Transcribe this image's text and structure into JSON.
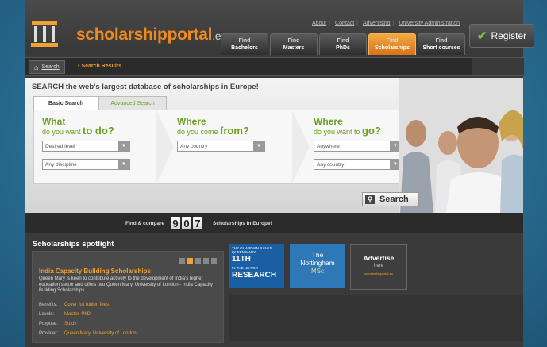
{
  "site": {
    "name": "scholarshipportal",
    "suffix": ".eu"
  },
  "top_links": [
    "About",
    "Contact",
    "Advertising",
    "University Administration"
  ],
  "nav_tabs": [
    {
      "line1": "Find",
      "line2": "Bachelors"
    },
    {
      "line1": "Find",
      "line2": "Masters"
    },
    {
      "line1": "Find",
      "line2": "PhDs"
    },
    {
      "line1": "Find",
      "line2": "Scholarships"
    },
    {
      "line1": "Find",
      "line2": "Short courses"
    }
  ],
  "register_label": "Register",
  "breadcrumb": {
    "home": "Search",
    "current": "Search Results"
  },
  "search": {
    "title": "SEARCH the web's largest database of scholarships in Europe!",
    "tabs": [
      "Basic Search",
      "Advanced Search"
    ],
    "col1": {
      "q1": "What",
      "q2a": "do you want ",
      "q2b": "to do?",
      "sel1": "Desired level",
      "sel2": "Any discipline"
    },
    "col2": {
      "q1": "Where",
      "q2a": "do you come ",
      "q2b": "from?",
      "sel1": "Any country"
    },
    "col3": {
      "q1": "Where",
      "q2a": "do you want to ",
      "q2b": "go?",
      "sel1": "Anywhere",
      "sel2": "Any country"
    },
    "button": "Search"
  },
  "counter": {
    "left": "Find & compare",
    "digits": [
      "9",
      "0",
      "7"
    ],
    "right": "Scholarships in Europe!"
  },
  "spotlight": {
    "title": "Scholarships spotlight",
    "pager_active": 1,
    "item_title": "India Capacity Building Scholarships",
    "item_desc": "Queen Mary is keen to contribute actively to the development of India's higher education sector and offers two Queen Mary, University of London - India Capacity Building Scholarships.",
    "benefits_label": "Benefits:",
    "benefits": "Cover full tuition fees",
    "levels_label": "Levels:",
    "levels": "Master, PhD",
    "purpose_label": "Purpose:",
    "purpose": "Study",
    "provider_label": "Provider:",
    "provider": "Queen Mary, University of London"
  },
  "ads": {
    "ad1": {
      "small": "THE GUARDIAN RANKS QUEEN MARY",
      "l1": "11TH",
      "l2": "IN THE UK FOR",
      "l3": "RESEARCH"
    },
    "ad2": {
      "l1": "The",
      "l2": "Nottingham",
      "l3": "MSc"
    },
    "ad3": {
      "l1": "Advertise",
      "l2": "here",
      "l3": "scholarshipportal.eu"
    }
  },
  "colors": {
    "accent": "#f08a1c",
    "green": "#6aa11e",
    "tab_active": "#e08a28"
  }
}
